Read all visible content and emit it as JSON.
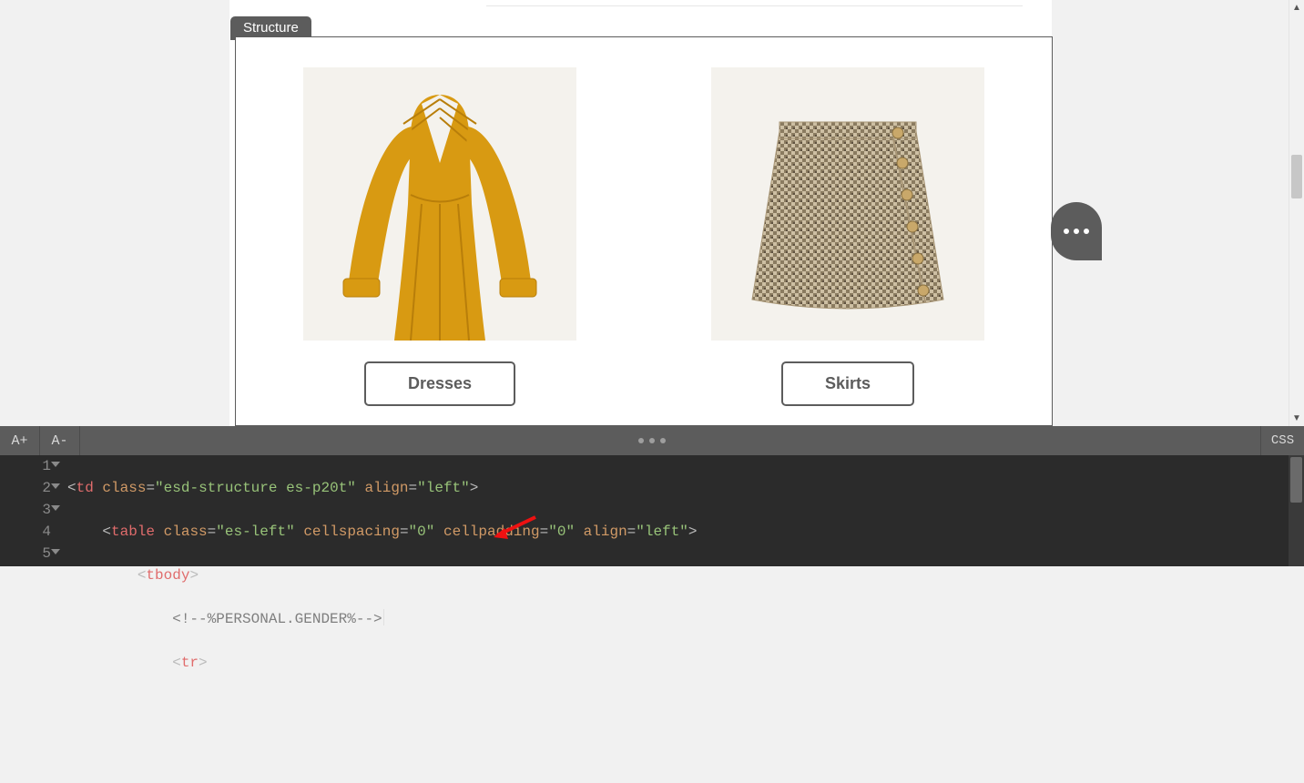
{
  "structure_tab_label": "Structure",
  "products": [
    {
      "button_label": "Dresses"
    },
    {
      "button_label": "Skirts"
    }
  ],
  "toolbar": {
    "zoom_in": "A+",
    "zoom_out": "A-",
    "css": "CSS"
  },
  "code": {
    "line_numbers": [
      "1",
      "2",
      "3",
      "4",
      "5"
    ],
    "l1_tag": "td",
    "l1_attr1": "class",
    "l1_val1": "esd-structure es-p20t",
    "l1_attr2": "align",
    "l1_val2": "left",
    "l2_tag": "table",
    "l2_attr1": "class",
    "l2_val1": "es-left",
    "l2_attr2": "cellspacing",
    "l2_val2": "0",
    "l2_attr3": "cellpadding",
    "l2_val3": "0",
    "l2_attr4": "align",
    "l2_val4": "left",
    "l3_tag": "tbody",
    "l4_comment": "<!--%PERSONAL.GENDER%-->",
    "l5_tag": "tr"
  }
}
